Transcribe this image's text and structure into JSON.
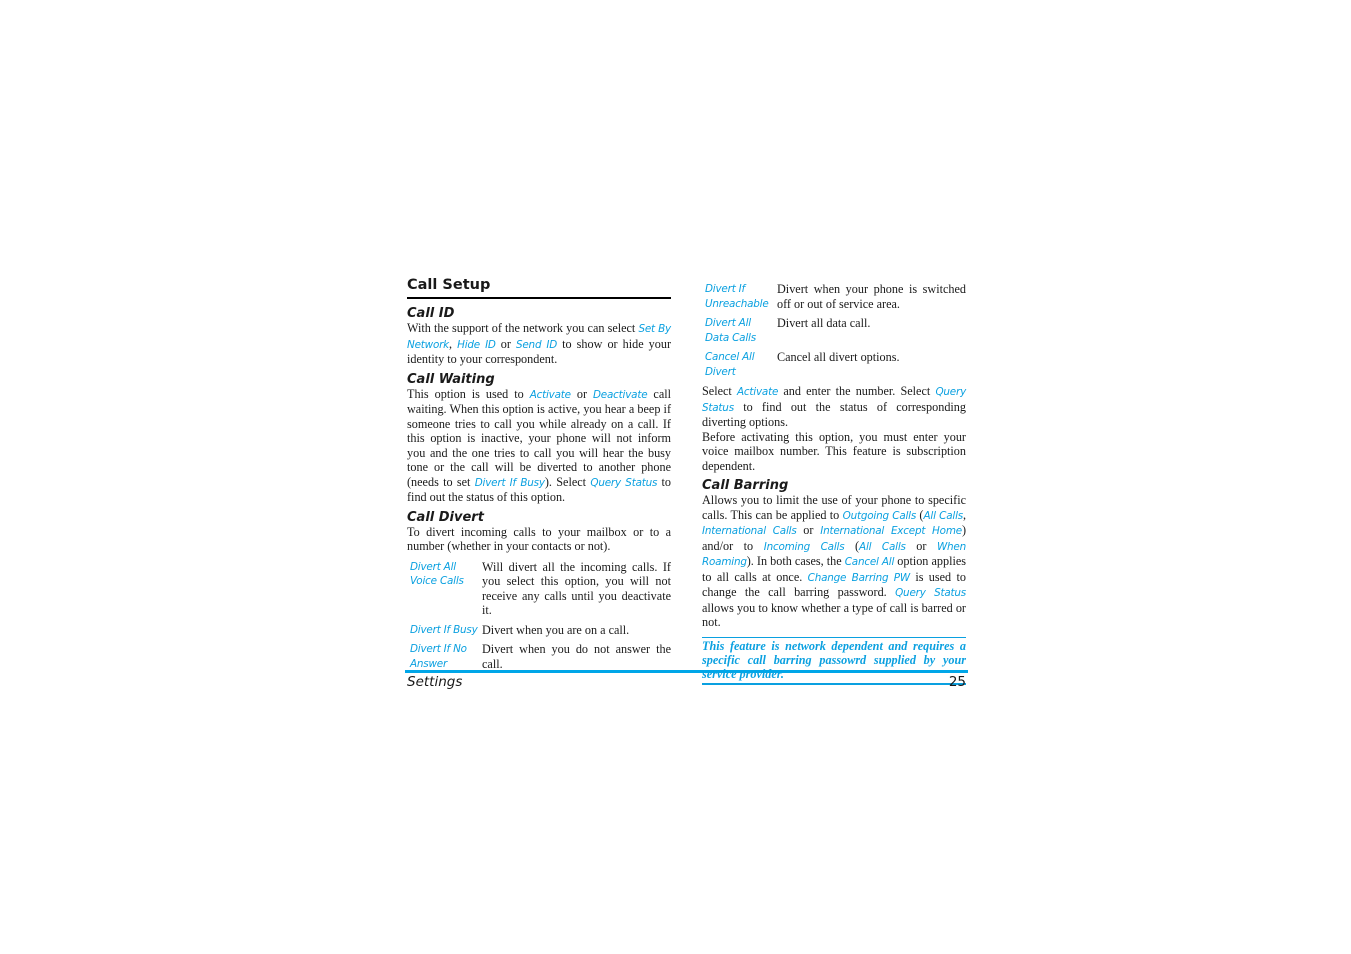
{
  "section_title": "Call Setup",
  "call_id": {
    "title": "Call ID",
    "t1": "With the support of the network you can select ",
    "l1": "Set By Network",
    "t2": ", ",
    "l2": "Hide ID",
    "t3": " or ",
    "l3": "Send ID",
    "t4": " to show or hide your identity to your correspondent."
  },
  "call_waiting": {
    "title": "Call Waiting",
    "t1": "This option is used to ",
    "l1": "Activate",
    "t2": " or ",
    "l2": "Deactivate",
    "t3": " call waiting. When this option is active, you hear a beep if someone tries to call you while already on a call. If this option is inactive, your phone will not inform you and the one tries to call you will hear the busy tone or the call will be diverted to another phone (needs to set ",
    "l3": "Divert If Busy",
    "t4": "). Select ",
    "l4": "Query Status",
    "t5": " to find out the status of this option."
  },
  "call_divert": {
    "title": "Call Divert",
    "intro": "To divert incoming calls to your mailbox or to a number (whether in your contacts or not).",
    "options": [
      {
        "key": "Divert All Voice Calls",
        "desc": "Will divert all the incoming calls. If you select this option, you will not receive any calls until you deactivate it."
      },
      {
        "key": "Divert If Busy",
        "desc": "Divert when you are on a call."
      },
      {
        "key": "Divert If No Answer",
        "desc": "Divert when you do not answer the call."
      },
      {
        "key": "Divert If Unreachable",
        "desc": "Divert when your phone is switched off or out of service area."
      },
      {
        "key": "Divert All Data Calls",
        "desc": "Divert all data call."
      },
      {
        "key": "Cancel All Divert",
        "desc": "Cancel all divert options."
      }
    ],
    "select": {
      "t1": "Select ",
      "l1": "Activate",
      "t2": " and enter the number. Select ",
      "l2": "Query Status",
      "t3": " to find out the status of corresponding diverting options."
    },
    "before": "Before activating this option, you must enter your voice mailbox number. This feature is subscription dependent."
  },
  "call_barring": {
    "title": "Call Barring",
    "t1": "Allows you to limit the use of your phone to specific calls. This can be applied to ",
    "l1": "Outgoing Calls",
    "t2": " (",
    "l2": "All Calls",
    "t3": ", ",
    "l3": "International Calls",
    "t4": " or ",
    "l4": "International Except Home",
    "t5": ") and/or to ",
    "l5": "Incoming Calls",
    "t6": " (",
    "l6": "All Calls",
    "t7": " or ",
    "l7": "When Roaming",
    "t8": "). In both cases, the ",
    "l8": "Cancel All",
    "t9": " option applies to all calls at once. ",
    "l9": "Change Barring PW",
    "t10": " is used to change the call barring password. ",
    "l10": "Query Status",
    "t11": " allows you to know whether a type of call is barred or not."
  },
  "note": "This feature is network dependent and requires a specific call barring passowrd supplied by your service provider.",
  "footer": {
    "chapter": "Settings",
    "page_number": "25"
  },
  "colors": {
    "accent": "#0aa0e0",
    "footer_rule": "#00a6e8",
    "text": "#1a1a1a"
  }
}
